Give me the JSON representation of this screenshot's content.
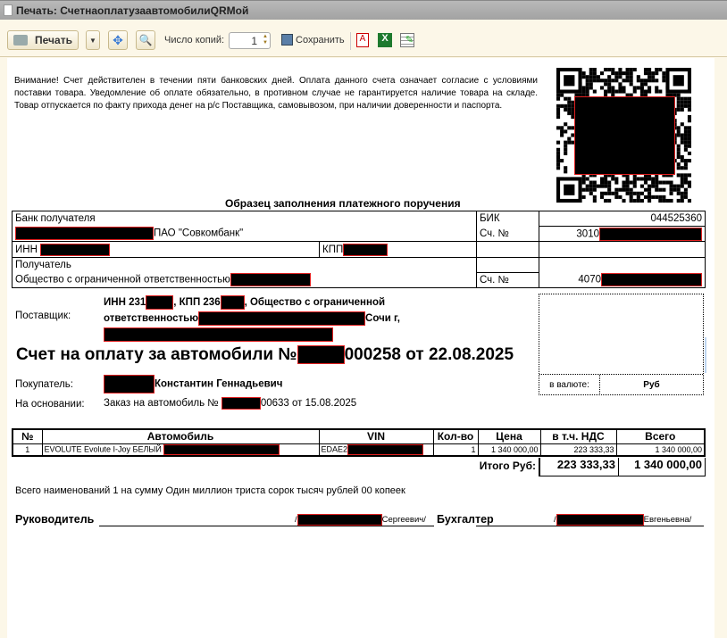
{
  "window": {
    "title": "Печать: СчетнаоплатузаавтомобилиQRМой"
  },
  "toolbar": {
    "print_label": "Печать",
    "copies_label": "Число копий:",
    "copies_value": "1",
    "save_label": "Сохранить"
  },
  "notice": "Внимание! Счет действителен в течении пяти банковских дней. Оплата данного счета означает согласие с условиями поставки товара. Уведомление об оплате обязательно, в противном случае не гарантируется наличие товара на складе. Товар отпускается по факту прихода денег на р/с Поставщика, самовывозом, при наличии доверенности и паспорта.",
  "payment": {
    "title": "Образец заполнения платежного поручения",
    "bank_label": "Банк получателя",
    "bank_name": "ПАО \"Совкомбанк\"",
    "bik_label": "БИК",
    "bik": "044525360",
    "acc_label": "Сч. №",
    "corr_acc_prefix": "3010",
    "inn_label": "ИНН",
    "kpp_label": "КПП",
    "recipient_label": "Получатель",
    "recipient_name": "Общество с ограниченной ответственностью",
    "acc_prefix": "4070"
  },
  "supplier": {
    "label": "Поставщик:",
    "inn": "ИНН 231",
    "kpp": ", КПП 236",
    "line1_tail": ", Общество с ограниченной",
    "line2_head": "ответственностью",
    "line2_tail": "Сочи г,"
  },
  "invoice": {
    "title_head": "Счет на оплату за автомобили №",
    "title_tail": "000258 от 22.08.2025"
  },
  "currency": {
    "label": "в валюте:",
    "value": "Руб"
  },
  "buyer": {
    "label": "Покупатель:",
    "name": "Константин Геннадьевич"
  },
  "basis": {
    "label": "На основании:",
    "head": "Заказ на автомобиль №",
    "tail": "00633 от 15.08.2025"
  },
  "table": {
    "headers": [
      "№",
      "Автомобиль",
      "VIN",
      "Кол-во",
      "Цена",
      "в т.ч. НДС",
      "Всего"
    ],
    "rows": [
      {
        "n": "1",
        "car": "EVOLUTE Evolute I-Joy БЕЛЫЙ",
        "vin": "EDAE2",
        "qty": "1",
        "price": "1 340 000,00",
        "vat": "223 333,33",
        "total": "1 340 000,00"
      }
    ],
    "total_label": "Итого Руб:",
    "total_vat": "223 333,33",
    "total_sum": "1 340 000,00"
  },
  "summary": "Всего наименований 1 на сумму Один миллион триста сорок тысяч рублей 00 копеек",
  "signatures": {
    "head_label": "Руководитель",
    "head_tail": "Сергеевич/",
    "acc_label": "Бухгалтер",
    "acc_tail": "Евгеньевна/"
  }
}
